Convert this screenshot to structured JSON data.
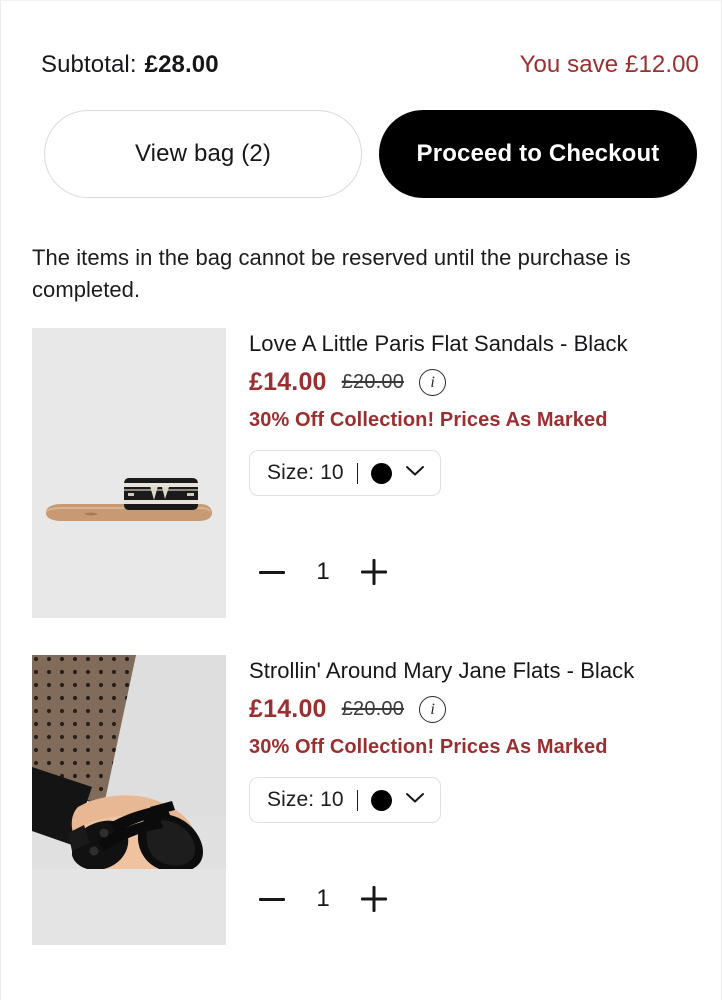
{
  "summary": {
    "subtotal_label": "Subtotal:",
    "subtotal_value": "£28.00",
    "savings": "You save £12.00"
  },
  "actions": {
    "view_bag": "View bag (2)",
    "checkout": "Proceed to Checkout"
  },
  "notice": "The items in the bag cannot be reserved until the purchase is completed.",
  "colors": {
    "accent_red": "#9b2f30",
    "primary_button_bg": "#000000",
    "text": "#17171a",
    "thumb_bg": "#e8e8e8"
  },
  "items": [
    {
      "title": "Love A Little Paris Flat Sandals - Black",
      "price_sale": "£14.00",
      "price_original": "£20.00",
      "info_icon_glyph": "i",
      "promo": "30% Off Collection! Prices As Marked",
      "size_label": "Size: 10",
      "swatch_color": "#000000",
      "quantity": "1",
      "decrease_label": "−",
      "increase_label": "+",
      "image_alt": "black and white strap flat sandal with tan sole on grey background"
    },
    {
      "title": "Strollin' Around Mary Jane Flats - Black",
      "price_sale": "£14.00",
      "price_original": "£20.00",
      "info_icon_glyph": "i",
      "promo": "30% Off Collection! Prices As Marked",
      "size_label": "Size: 10",
      "swatch_color": "#000000",
      "quantity": "1",
      "decrease_label": "−",
      "increase_label": "+",
      "image_alt": "model wearing black patent double-strap mary jane flats with polka dot tights"
    }
  ]
}
